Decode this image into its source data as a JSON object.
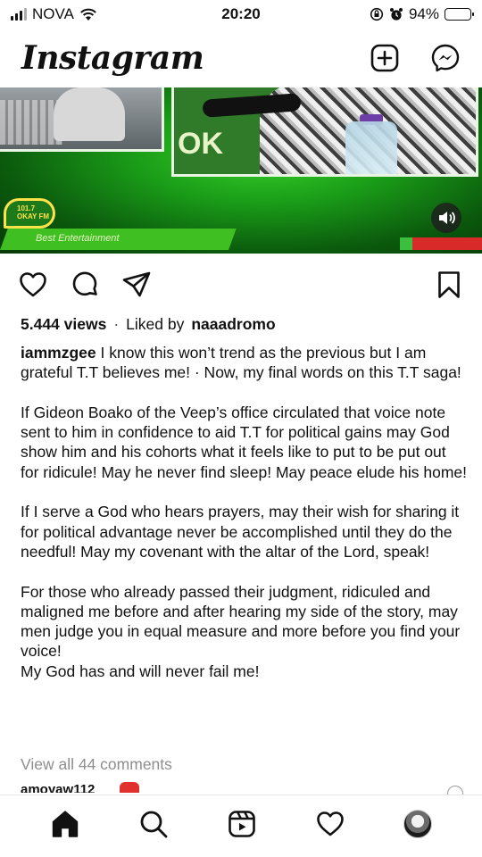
{
  "status_bar": {
    "carrier": "NOVA",
    "time": "20:20",
    "battery_percent": "94%",
    "battery_level": 0.94,
    "icons": [
      "signal-icon",
      "wifi-icon",
      "rotation-lock-icon",
      "alarm-icon",
      "battery-icon"
    ]
  },
  "header": {
    "logo_text": "Instagram",
    "icons": [
      "new-post-icon",
      "messenger-icon"
    ]
  },
  "media": {
    "lower_third_text": "Best Entertainment",
    "station_logo_text": "101.7 OKAY FM",
    "overlay_text": "OK",
    "sound_icon": "speaker-icon",
    "colors": {
      "primary_green": "#1a9c18",
      "ticker_red": "#d92a2a"
    }
  },
  "actions": {
    "icons": [
      "heart-icon",
      "comment-icon",
      "share-icon",
      "bookmark-icon"
    ]
  },
  "post": {
    "views": "5.444 views",
    "separator": "·",
    "liked_by_prefix": "Liked by",
    "liked_by_user": "naaadromo",
    "username": "iammzgee",
    "caption_first": "I know this won’t trend as the previous but I am grateful T.T believes me! · Now, my final words on this T.T saga!",
    "caption_p2": "If Gideon Boako of the Veep’s office circulated that voice note sent to him in confidence to aid T.T for political gains may God show him and his cohorts what it feels like to put to be put out for ridicule! May he never find sleep! May peace elude his home!",
    "caption_p3": "If I serve a God who hears prayers, may their wish for sharing it for political advantage never be accomplished until they do the needful! May my covenant with the altar of the Lord, speak!",
    "caption_p4": "For those who already passed their judgment, ridiculed and maligned me before and after hearing my side of the story, may men judge you in equal measure and more before you find your voice!",
    "caption_p5": "My God has and will never fail me!",
    "view_comments": "View all 44 comments",
    "peek_comment_user": "amoyaw112"
  },
  "bottom_nav": {
    "icons": [
      "home-icon",
      "search-icon",
      "reels-icon",
      "activity-heart-icon",
      "profile-avatar"
    ]
  }
}
